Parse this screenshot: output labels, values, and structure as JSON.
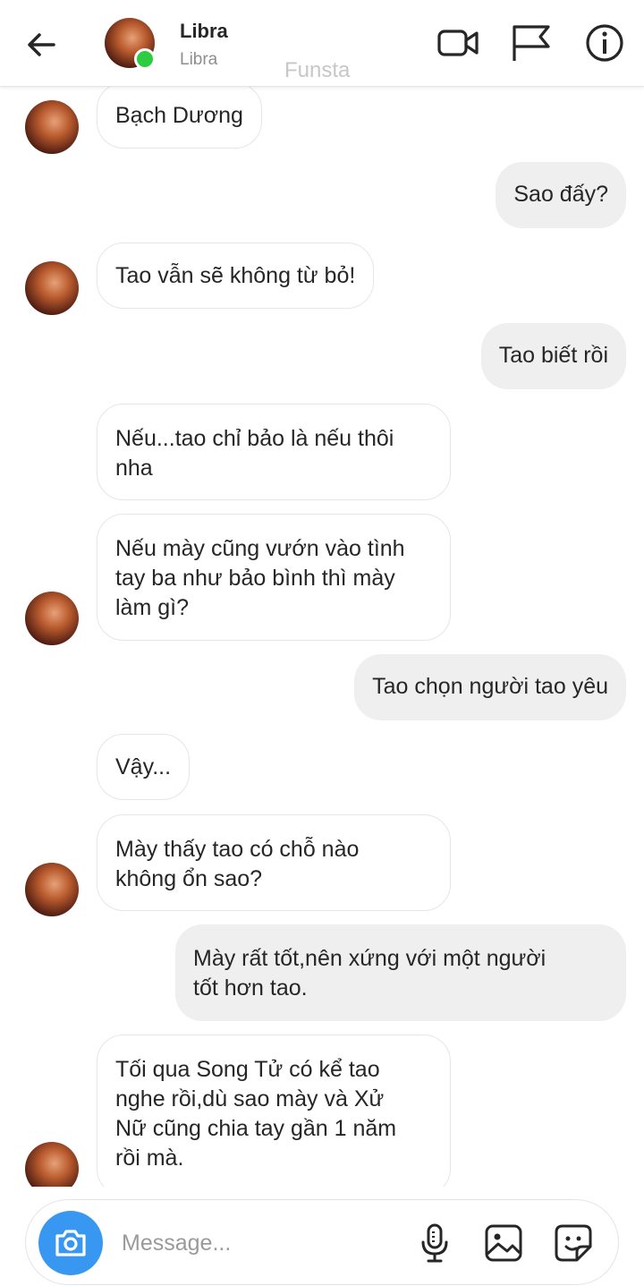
{
  "header": {
    "title": "Libra",
    "subtitle": "Libra",
    "watermark": "Funsta",
    "icons": [
      "back-arrow-icon",
      "video-call-icon",
      "flag-icon",
      "info-icon"
    ]
  },
  "messages": [
    {
      "from": "them",
      "text": "Bạch Dương"
    },
    {
      "from": "me",
      "text": "Sao đấy?"
    },
    {
      "from": "them",
      "text": "Tao vẫn sẽ không từ bỏ!"
    },
    {
      "from": "me",
      "text": "Tao biết rồi"
    },
    {
      "from": "them",
      "text": "Nếu...tao chỉ bảo là nếu thôi\nnha"
    },
    {
      "from": "them",
      "text": "Nếu mày cũng vướn vào tình\ntay ba như bảo bình thì mày\nlàm gì?"
    },
    {
      "from": "me",
      "text": "Tao chọn người tao yêu"
    },
    {
      "from": "them",
      "text": "Vậy..."
    },
    {
      "from": "them",
      "text": "Mày thấy tao có chỗ nào\nkhông ổn sao?"
    },
    {
      "from": "me",
      "text": "Mày rất tốt,nên xứng với một người\ntốt hơn tao."
    },
    {
      "from": "them",
      "text": "Tối qua Song Tử có kể tao\nnghe rồi,dù sao mày và Xử\nNữ cũng chia tay gần 1 năm\nrồi mà."
    }
  ],
  "composer": {
    "placeholder": "Message...",
    "icons": [
      "camera-icon",
      "microphone-icon",
      "gallery-icon",
      "sticker-icon"
    ]
  },
  "colors": {
    "accent": "#3897f0",
    "online": "#2ecc40",
    "sent_bubble": "#efefef"
  }
}
